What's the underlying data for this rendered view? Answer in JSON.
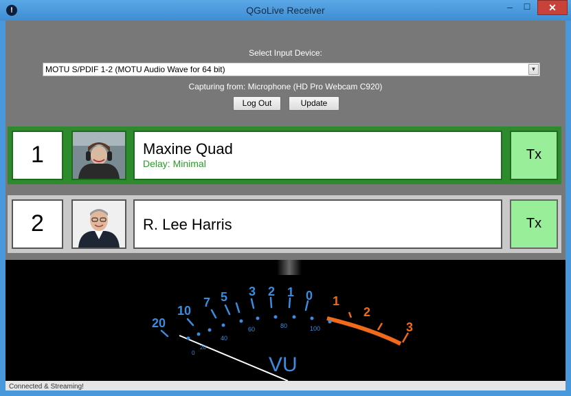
{
  "window": {
    "title": "QGoLive Receiver",
    "min_glyph": "–",
    "max_glyph": "☐",
    "close_glyph": "✕"
  },
  "device": {
    "select_label": "Select Input Device:",
    "selected_device": "MOTU S/PDIF 1-2 (MOTU Audio Wave for 64 bit)",
    "capturing": "Capturing from: Microphone (HD Pro Webcam C920)",
    "logout_label": "Log Out",
    "update_label": "Update"
  },
  "participants": [
    {
      "number": "1",
      "name": "Maxine Quad",
      "delay": "Delay: Minimal",
      "tx_label": "Tx",
      "active": true
    },
    {
      "number": "2",
      "name": "R. Lee Harris",
      "delay": "",
      "tx_label": "Tx",
      "active": false
    }
  ],
  "vu": {
    "label": "VU",
    "upper_scale": [
      "20",
      "10",
      "7",
      "5",
      "3",
      "2",
      "1",
      "0",
      "1",
      "2",
      "3"
    ],
    "lower_scale": [
      "0",
      "20",
      "40",
      "60",
      "80",
      "100"
    ],
    "scale_color": "#3a8de0",
    "red_color": "#f06a1a"
  },
  "status": {
    "text": "Connected & Streaming!"
  }
}
